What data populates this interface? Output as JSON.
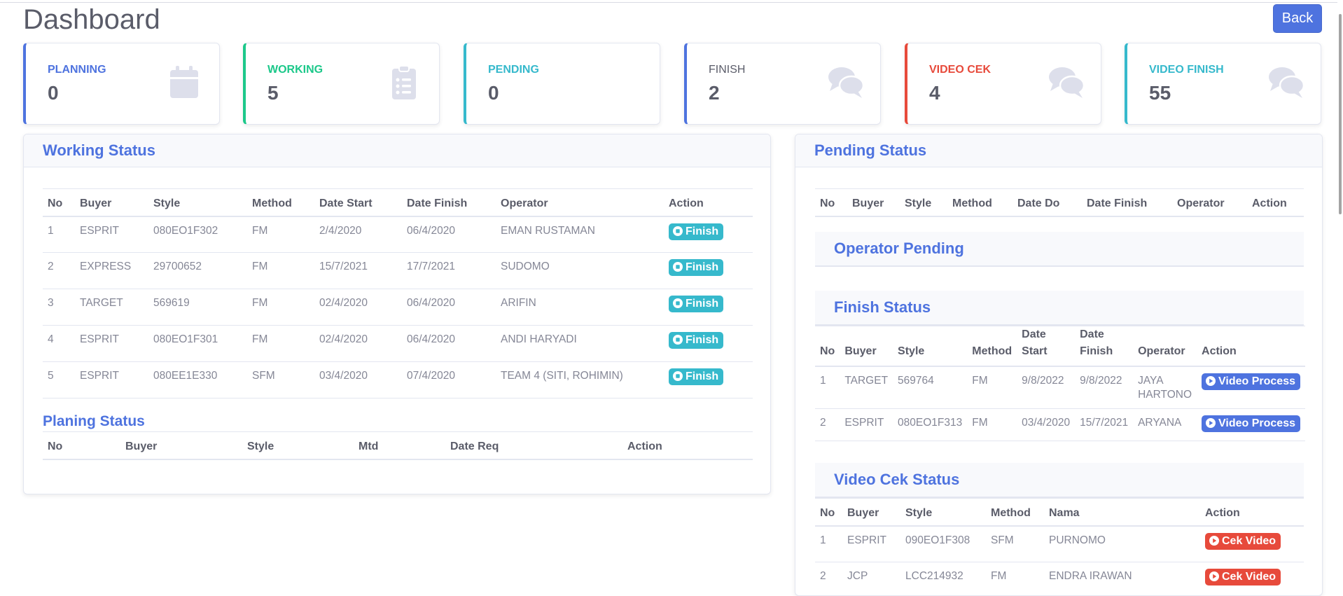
{
  "header": {
    "title": "Dashboard",
    "back_label": "Back"
  },
  "stats": [
    {
      "label": "PLANNING",
      "value": "0",
      "color": "#4e73df",
      "icon": "calendar-icon"
    },
    {
      "label": "WORKING",
      "value": "5",
      "color": "#1cc88a",
      "icon": "clipboard-list-icon"
    },
    {
      "label": "PENDING",
      "value": "0",
      "color": "#36b9cc",
      "icon": "none"
    },
    {
      "label": "FINISH",
      "value": "2",
      "color": "#4e73df",
      "icon": "comments-icon"
    },
    {
      "label": "VIDEO CEK",
      "value": "4",
      "color": "#e74a3b",
      "icon": "comments-icon"
    },
    {
      "label": "VIDEO FINISH",
      "value": "55",
      "color": "#36b9cc",
      "icon": "comments-icon"
    }
  ],
  "working": {
    "title": "Working Status",
    "headers": [
      "No",
      "Buyer",
      "Style",
      "Method",
      "Date Start",
      "Date Finish",
      "Operator",
      "Action"
    ],
    "rows": [
      [
        "1",
        "ESPRIT",
        "080EO1F302",
        "FM",
        "2/4/2020",
        "06/4/2020",
        "EMAN RUSTAMAN",
        "Finish"
      ],
      [
        "2",
        "EXPRESS",
        "29700652",
        "FM",
        "15/7/2021",
        "17/7/2021",
        "SUDOMO",
        "Finish"
      ],
      [
        "3",
        "TARGET",
        "569619",
        "FM",
        "02/4/2020",
        "06/4/2020",
        "ARIFIN",
        "Finish"
      ],
      [
        "4",
        "ESPRIT",
        "080EO1F301",
        "FM",
        "02/4/2020",
        "06/4/2020",
        "ANDI HARYADI",
        "Finish"
      ],
      [
        "5",
        "ESPRIT",
        "080EE1E330",
        "SFM",
        "03/4/2020",
        "07/4/2020",
        "TEAM 4 (SITI, ROHIMIN)",
        "Finish"
      ]
    ]
  },
  "planing": {
    "title": "Planing Status",
    "headers": [
      "No",
      "Buyer",
      "Style",
      "Mtd",
      "Date Req",
      "Action"
    ]
  },
  "pending": {
    "title": "Pending Status",
    "headers": [
      "No",
      "Buyer",
      "Style",
      "Method",
      "Date Do",
      "Date Finish",
      "Operator",
      "Action"
    ]
  },
  "operator_pending": {
    "title": "Operator Pending"
  },
  "finish": {
    "title": "Finish Status",
    "headers": [
      "No",
      "Buyer",
      "Style",
      "Method",
      "Date Start",
      "Date Finish",
      "Operator",
      "Action"
    ],
    "rows": [
      [
        "1",
        "TARGET",
        "569764",
        "FM",
        "9/8/2022",
        "9/8/2022",
        "JAYA HARTONO",
        "Video Process"
      ],
      [
        "2",
        "ESPRIT",
        "080EO1F313",
        "FM",
        "03/4/2020",
        "15/7/2021",
        "ARYANA",
        "Video Process"
      ]
    ]
  },
  "video_cek": {
    "title": "Video Cek Status",
    "headers": [
      "No",
      "Buyer",
      "Style",
      "Method",
      "Nama",
      "Action"
    ],
    "rows": [
      [
        "1",
        "ESPRIT",
        "090EO1F308",
        "SFM",
        "PURNOMO",
        "Cek Video"
      ],
      [
        "2",
        "JCP",
        "LCC214932",
        "FM",
        "ENDRA IRAWAN",
        "Cek Video"
      ]
    ]
  }
}
